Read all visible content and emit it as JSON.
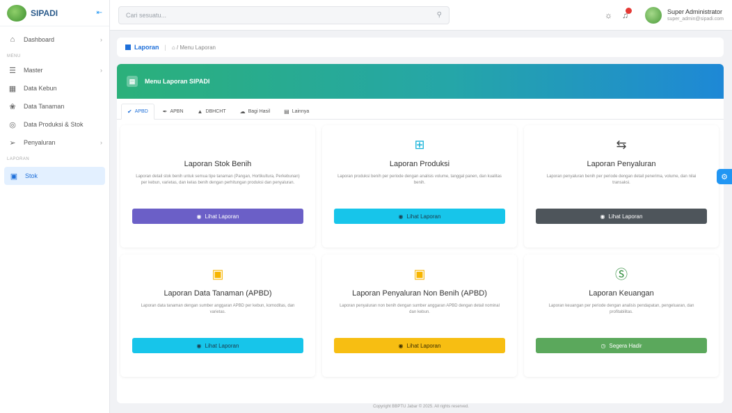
{
  "app": {
    "name": "SIPADI",
    "collapse_icon": "collapse-icon"
  },
  "sidebar": {
    "items": [
      {
        "label": "Dashboard",
        "icon": "home-icon"
      }
    ],
    "section_menu": "MENU",
    "menu_items": [
      {
        "label": "Master",
        "icon": "database-icon"
      },
      {
        "label": "Data Kebun",
        "icon": "table-icon"
      },
      {
        "label": "Data Tanaman",
        "icon": "plant-icon"
      },
      {
        "label": "Data Produksi & Stok",
        "icon": "box-icon"
      },
      {
        "label": "Penyaluran",
        "icon": "send-icon"
      }
    ],
    "section_laporan": "LAPORAN",
    "active_item": {
      "label": "Stok",
      "icon": "calendar-icon"
    }
  },
  "topbar": {
    "search_placeholder": "Cari sesuatu...",
    "user_name": "Super Administrator",
    "user_email": "super_admin@sipadi.com"
  },
  "breadcrumb": {
    "title": "Laporan",
    "path": "/ Menu Laporan"
  },
  "banner": {
    "title": "Menu Laporan SIPADI"
  },
  "tabs": [
    {
      "label": "APBD",
      "active": true
    },
    {
      "label": "APBN"
    },
    {
      "label": "DBHCHT"
    },
    {
      "label": "Bagi Hasil"
    },
    {
      "label": "Lainnya"
    }
  ],
  "cards": [
    {
      "title": "Laporan Stok Benih",
      "desc": "Laporan detail stok benih untuk semua tipe tanaman (Pangan, Hortikultura, Perkebunan) per kebun, varietas, dan kelas benih dengan perhitungan produksi dan penyaluran.",
      "button": "Lihat Laporan",
      "icon": "none",
      "color": "#6b5fc7"
    },
    {
      "title": "Laporan Produksi",
      "desc": "Laporan produksi benih per periode dengan analisis volume, tanggal panen, dan kualitas benih.",
      "button": "Lihat Laporan",
      "icon": "bar-chart-icon",
      "color": "#17c5ea"
    },
    {
      "title": "Laporan Penyaluran",
      "desc": "Laporan penyaluran benih per periode dengan detail penerima, volume, dan nilai transaksi.",
      "button": "Lihat Laporan",
      "icon": "exchange-icon",
      "color": "#4e555b"
    },
    {
      "title": "Laporan Data Tanaman (APBD)",
      "desc": "Laporan data tanaman dengan sumber anggaran APBD per kebun, komoditas, dan varietas.",
      "button": "Lihat Laporan",
      "icon": "money-icon",
      "color": "#17c5ea"
    },
    {
      "title": "Laporan Penyaluran Non Benih (APBD)",
      "desc": "Laporan penyaluran non benih dengan sumber anggaran APBD dengan detail nominal dan kebun.",
      "button": "Lihat Laporan",
      "icon": "money-icon",
      "color": "#f7be12"
    },
    {
      "title": "Laporan Keuangan",
      "desc": "Laporan keuangan per periode dengan analisis pendapatan, pengeluaran, dan profitabilitas.",
      "button": "Segera Hadir",
      "icon": "dollar-circle-icon",
      "color": "#5ba85c"
    }
  ],
  "footer": "Copyright BBPTU Jabar © 2025. All rights reserved."
}
